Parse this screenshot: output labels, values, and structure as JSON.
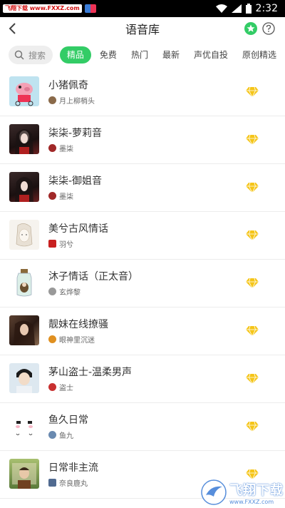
{
  "statusbar": {
    "badge": "飞翔下载 www.FXXZ.com",
    "time": "2:32"
  },
  "header": {
    "title": "语音库"
  },
  "tabs": {
    "search_label": "搜索",
    "items": [
      {
        "label": "精品",
        "active": true
      },
      {
        "label": "免费"
      },
      {
        "label": "热门"
      },
      {
        "label": "最新"
      },
      {
        "label": "声优自投"
      },
      {
        "label": "原创精选"
      }
    ]
  },
  "list": [
    {
      "name": "小猪佩奇",
      "author": "月上柳梢头"
    },
    {
      "name": "柒柒-萝莉音",
      "author": "墨柒"
    },
    {
      "name": "柒柒-御姐音",
      "author": "墨柒"
    },
    {
      "name": "美兮古风情话",
      "author": "羽兮"
    },
    {
      "name": "沐子情话（正太音）",
      "author": "玄烨黎"
    },
    {
      "name": "靓妹在线撩骚",
      "author": "眼神里沉迷"
    },
    {
      "name": "茅山盗士-温柔男声",
      "author": "盗士"
    },
    {
      "name": "鱼久日常",
      "author": "鱼九"
    },
    {
      "name": "日常非主流",
      "author": "奈良鹿丸"
    }
  ],
  "watermark": {
    "main": "飞翔下载",
    "sub": "www.FXXZ.com"
  },
  "colors": {
    "accent": "#33cc66",
    "vip": "#f5c518"
  }
}
